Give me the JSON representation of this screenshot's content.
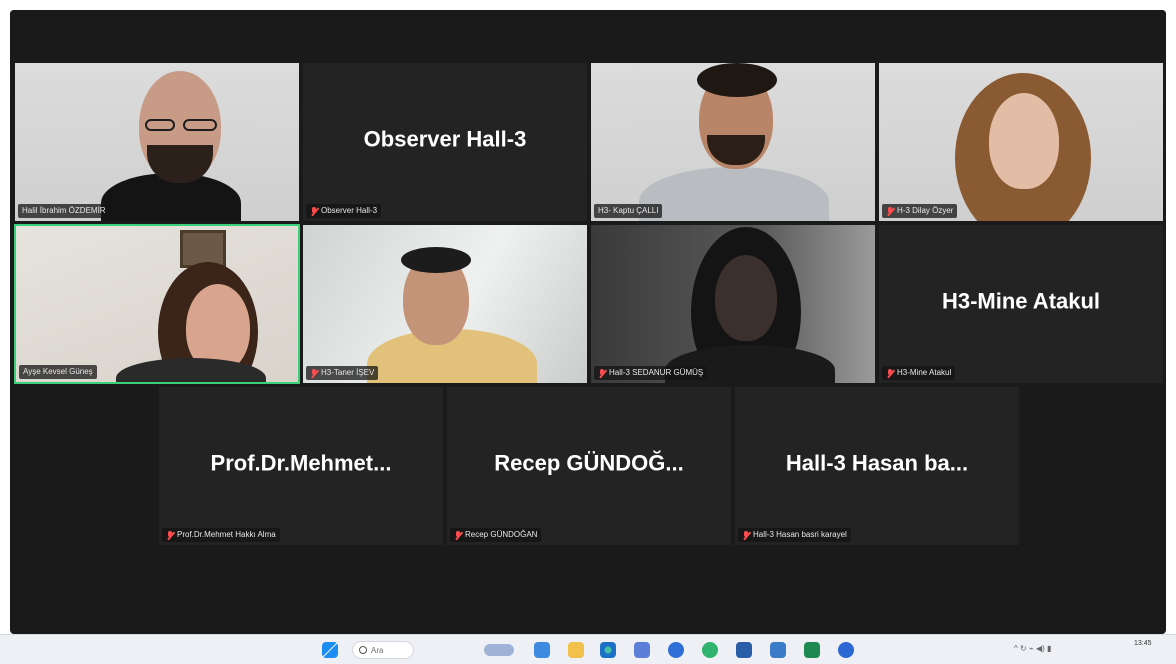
{
  "participants": {
    "p1": {
      "label": "Halil İbrahim ÖZDEMİR"
    },
    "p2": {
      "name": "Observer Hall-3",
      "label": "Observer Hall-3"
    },
    "p3": {
      "label": "H3- Kaptu ÇALLI"
    },
    "p4": {
      "label": "H-3 Dilay Özyer"
    },
    "p5": {
      "label": "Ayşe Kevsel Güneş"
    },
    "p6": {
      "label": "H3-Taner İŞEV"
    },
    "p7": {
      "label": "Hall-3 SEDANUR GÜMÜŞ"
    },
    "p8": {
      "name": "H3-Mine Atakul",
      "label": "H3-Mine Atakul"
    },
    "p9": {
      "name": "Prof.Dr.Mehmet...",
      "label": "Prof.Dr.Mehmet Hakkı Alma"
    },
    "p10": {
      "name": "Recep  GÜNDOĞ...",
      "label": "Recep GÜNDOĞAN"
    },
    "p11": {
      "name": "Hall-3  Hasan  ba...",
      "label": "Hall-3 Hasan basri karayel"
    }
  },
  "taskbar": {
    "search_placeholder": "Ara",
    "tray_text": "^  ↻  ⌁  ◀)  ▮",
    "clock_time": "13:45"
  },
  "colors": {
    "meeting_bg": "#1a1a1a",
    "tile_bg": "#232323",
    "active_speaker": "#3ccf7a",
    "muted": "#ff4b4b"
  }
}
